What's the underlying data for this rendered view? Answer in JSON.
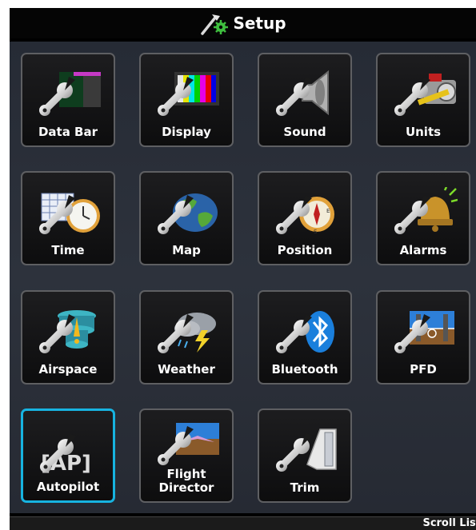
{
  "header": {
    "title": "Setup",
    "icon": "setup-tools-icon"
  },
  "tiles": [
    {
      "label": "Data Bar",
      "icon": "data-bar-icon"
    },
    {
      "label": "Display",
      "icon": "display-icon"
    },
    {
      "label": "Sound",
      "icon": "sound-icon"
    },
    {
      "label": "Units",
      "icon": "units-icon"
    },
    {
      "label": "Time",
      "icon": "time-icon"
    },
    {
      "label": "Map",
      "icon": "map-icon"
    },
    {
      "label": "Position",
      "icon": "position-icon"
    },
    {
      "label": "Alarms",
      "icon": "alarms-icon"
    },
    {
      "label": "Airspace",
      "icon": "airspace-icon"
    },
    {
      "label": "Weather",
      "icon": "weather-icon"
    },
    {
      "label": "Bluetooth",
      "icon": "bluetooth-icon"
    },
    {
      "label": "PFD",
      "icon": "pfd-icon"
    },
    {
      "label": "Autopilot",
      "icon": "autopilot-icon",
      "selected": true,
      "icon_text": "[AP]"
    },
    {
      "label": "Flight\nDirector",
      "icon": "flight-director-icon"
    },
    {
      "label": "Trim",
      "icon": "trim-icon"
    }
  ],
  "footer": {
    "scroll_label": "Scroll List"
  },
  "colors": {
    "selection": "#17b3e0",
    "tile_border": "#5e5f62",
    "background": "#2a2f39"
  }
}
